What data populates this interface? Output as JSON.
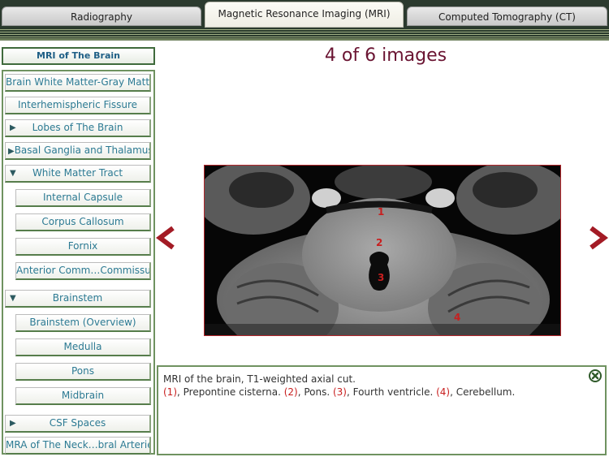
{
  "tabs": [
    {
      "label": "Radiography",
      "active": false
    },
    {
      "label": "Magnetic Resonance Imaging (MRI)",
      "active": true
    },
    {
      "label": "Computed Tomography (CT)",
      "active": false
    }
  ],
  "sidebar": {
    "title": "MRI of The Brain",
    "items": [
      {
        "label": "Brain White Matter-Gray Matter",
        "indicator": ""
      },
      {
        "label": "Interhemispheric Fissure",
        "indicator": ""
      },
      {
        "label": "Lobes of The Brain",
        "indicator": "▶"
      },
      {
        "label": "Basal Ganglia and Thalamus",
        "indicator": "▶"
      },
      {
        "label": "White Matter Tract",
        "indicator": "▼"
      },
      {
        "label": "Internal Capsule",
        "indicator": ""
      },
      {
        "label": "Corpus Callosum",
        "indicator": ""
      },
      {
        "label": "Fornix",
        "indicator": ""
      },
      {
        "label": "Anterior Comm…Commissure",
        "indicator": ""
      },
      {
        "label": "Brainstem",
        "indicator": "▼"
      },
      {
        "label": "Brainstem (Overview)",
        "indicator": ""
      },
      {
        "label": "Medulla",
        "indicator": ""
      },
      {
        "label": "Pons",
        "indicator": ""
      },
      {
        "label": "Midbrain",
        "indicator": ""
      },
      {
        "label": "CSF Spaces",
        "indicator": "▶"
      },
      {
        "label": "MRA of The Neck…bral Arteries)",
        "indicator": ""
      }
    ]
  },
  "viewer": {
    "counter": "4 of 6 images",
    "markers": [
      "1",
      "2",
      "3",
      "4"
    ]
  },
  "caption": {
    "line1": "MRI of the brain, T1-weighted axial cut.",
    "items": [
      {
        "num": "(1)",
        "text": ", Prepontine cisterna. "
      },
      {
        "num": "(2)",
        "text": ", Pons. "
      },
      {
        "num": "(3)",
        "text": ", Fourth ventricle. "
      },
      {
        "num": "(4)",
        "text": ", Cerebellum."
      }
    ]
  },
  "colors": {
    "accent_text": "#2c7a93",
    "counter": "#6a1432",
    "arrow": "#a31b25",
    "marker": "#c81f1f",
    "border": "#6f9260"
  },
  "icons": {
    "prev": "chevron-left-icon",
    "next": "chevron-right-icon",
    "close": "close-circle-icon"
  }
}
